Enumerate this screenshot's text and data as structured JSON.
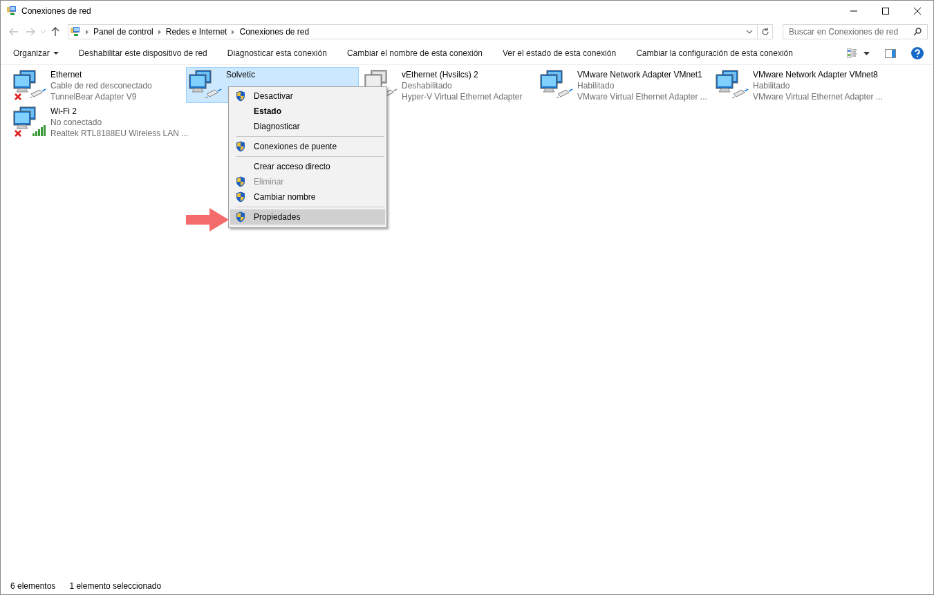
{
  "window": {
    "title": "Conexiones de red"
  },
  "address_bar": {
    "breadcrumbs": [
      "Panel de control",
      "Redes e Internet",
      "Conexiones de red"
    ]
  },
  "search": {
    "placeholder": "Buscar en Conexiones de red"
  },
  "toolbar": [
    {
      "label": "Organizar",
      "dropdown": true
    },
    {
      "label": "Deshabilitar este dispositivo de red",
      "dropdown": false
    },
    {
      "label": "Diagnosticar esta conexión",
      "dropdown": false
    },
    {
      "label": "Cambiar el nombre de esta conexión",
      "dropdown": false
    },
    {
      "label": "Ver el estado de esta conexión",
      "dropdown": false
    },
    {
      "label": "Cambiar la configuración de esta conexión",
      "dropdown": false
    }
  ],
  "connections": [
    {
      "name": "Ethernet",
      "status": "Cable de red desconectado",
      "adapter": "TunnelBear Adapter V9",
      "kind": "ethernet",
      "disconnected": true,
      "disabled": false,
      "selected": false
    },
    {
      "name": "Solvetic",
      "kind": "ethernet",
      "disconnected": false,
      "disabled": false,
      "selected": true
    },
    {
      "name": "vEthernet (Hvsilcs) 2",
      "status": "Deshabilitado",
      "adapter": "Hyper-V Virtual Ethernet Adapter",
      "kind": "ethernet",
      "disconnected": false,
      "disabled": true,
      "selected": false
    },
    {
      "name": "VMware Network Adapter VMnet1",
      "status": "Habilitado",
      "adapter": "VMware Virtual Ethernet Adapter ...",
      "kind": "ethernet",
      "disconnected": false,
      "disabled": false,
      "selected": false
    },
    {
      "name": "VMware Network Adapter VMnet8",
      "status": "Habilitado",
      "adapter": "VMware Virtual Ethernet Adapter ...",
      "kind": "ethernet",
      "disconnected": false,
      "disabled": false,
      "selected": false
    },
    {
      "name": "Wi-Fi 2",
      "status": "No conectado",
      "adapter": "Realtek RTL8188EU Wireless LAN ...",
      "kind": "wifi",
      "disconnected": true,
      "disabled": false,
      "selected": false
    }
  ],
  "context_menu": {
    "groups": [
      {
        "items": [
          {
            "label": "Desactivar",
            "kind": "normal",
            "shield": true,
            "selected": false
          },
          {
            "label": "Estado",
            "kind": "default",
            "shield": false,
            "selected": false
          },
          {
            "label": "Diagnosticar",
            "kind": "normal",
            "shield": false,
            "selected": false
          }
        ]
      },
      {
        "items": [
          {
            "label": "Conexiones de puente",
            "kind": "normal",
            "shield": true,
            "selected": false
          }
        ]
      },
      {
        "items": [
          {
            "label": "Crear acceso directo",
            "kind": "normal",
            "shield": false,
            "selected": false
          },
          {
            "label": "Eliminar",
            "kind": "disabled",
            "shield": true,
            "selected": false
          },
          {
            "label": "Cambiar nombre",
            "kind": "normal",
            "shield": true,
            "selected": false
          }
        ]
      },
      {
        "items": [
          {
            "label": "Propiedades",
            "kind": "normal",
            "shield": true,
            "selected": true
          }
        ]
      }
    ]
  },
  "status_bar": {
    "count": "6 elementos",
    "selection": "1 elemento seleccionado"
  }
}
